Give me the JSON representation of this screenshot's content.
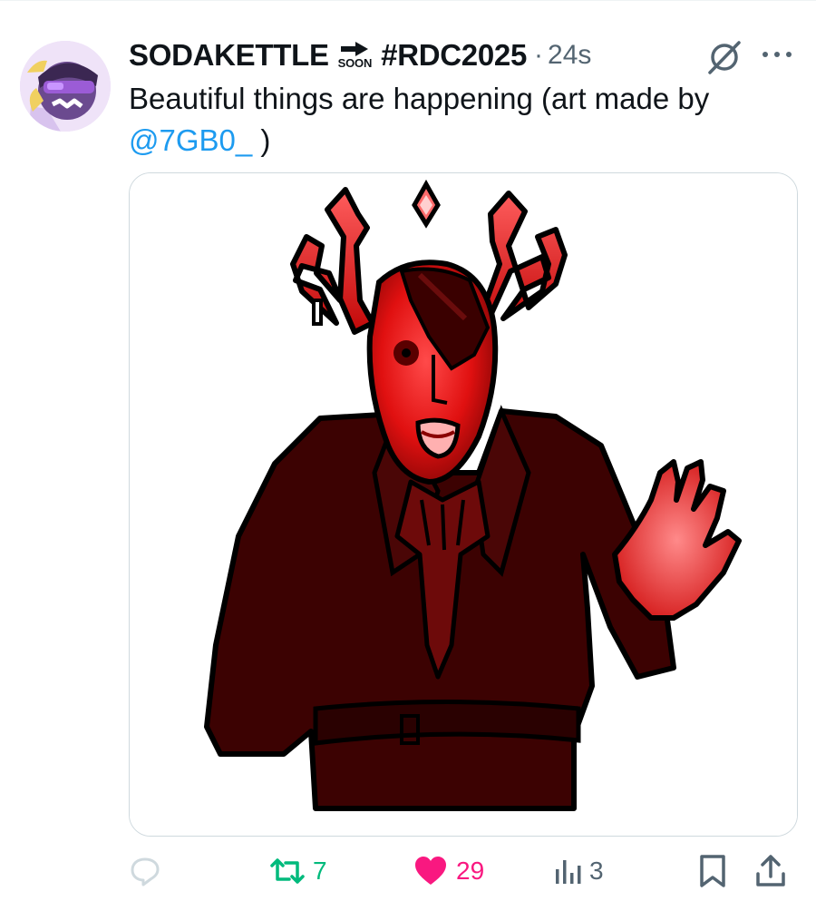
{
  "tweet": {
    "author": {
      "display_name": "SODAKETTLE",
      "badge_text": "SOON",
      "badge_icon": "right-arrow-icon",
      "hashtag": "#RDC2025"
    },
    "separator": "·",
    "timestamp": "24s",
    "text": "Beautiful things are happening (art made by ",
    "mention": "@7GB0_",
    "text_suffix": " )",
    "media": {
      "description_icon": "drawing-of-red-antlered-figure"
    },
    "actions": {
      "reply": {
        "icon": "reply-icon",
        "count": ""
      },
      "retweet": {
        "icon": "retweet-icon",
        "count": "7"
      },
      "like": {
        "icon": "heart-icon",
        "count": "29"
      },
      "views": {
        "icon": "views-icon",
        "count": "3"
      },
      "bookmark": {
        "icon": "bookmark-icon"
      },
      "share": {
        "icon": "share-icon"
      }
    }
  },
  "colors": {
    "accent": "#1d9bf0",
    "retweet": "#00ba7c",
    "like": "#f91880",
    "muted": "#536471",
    "reply_faded": "#cfd9de"
  }
}
